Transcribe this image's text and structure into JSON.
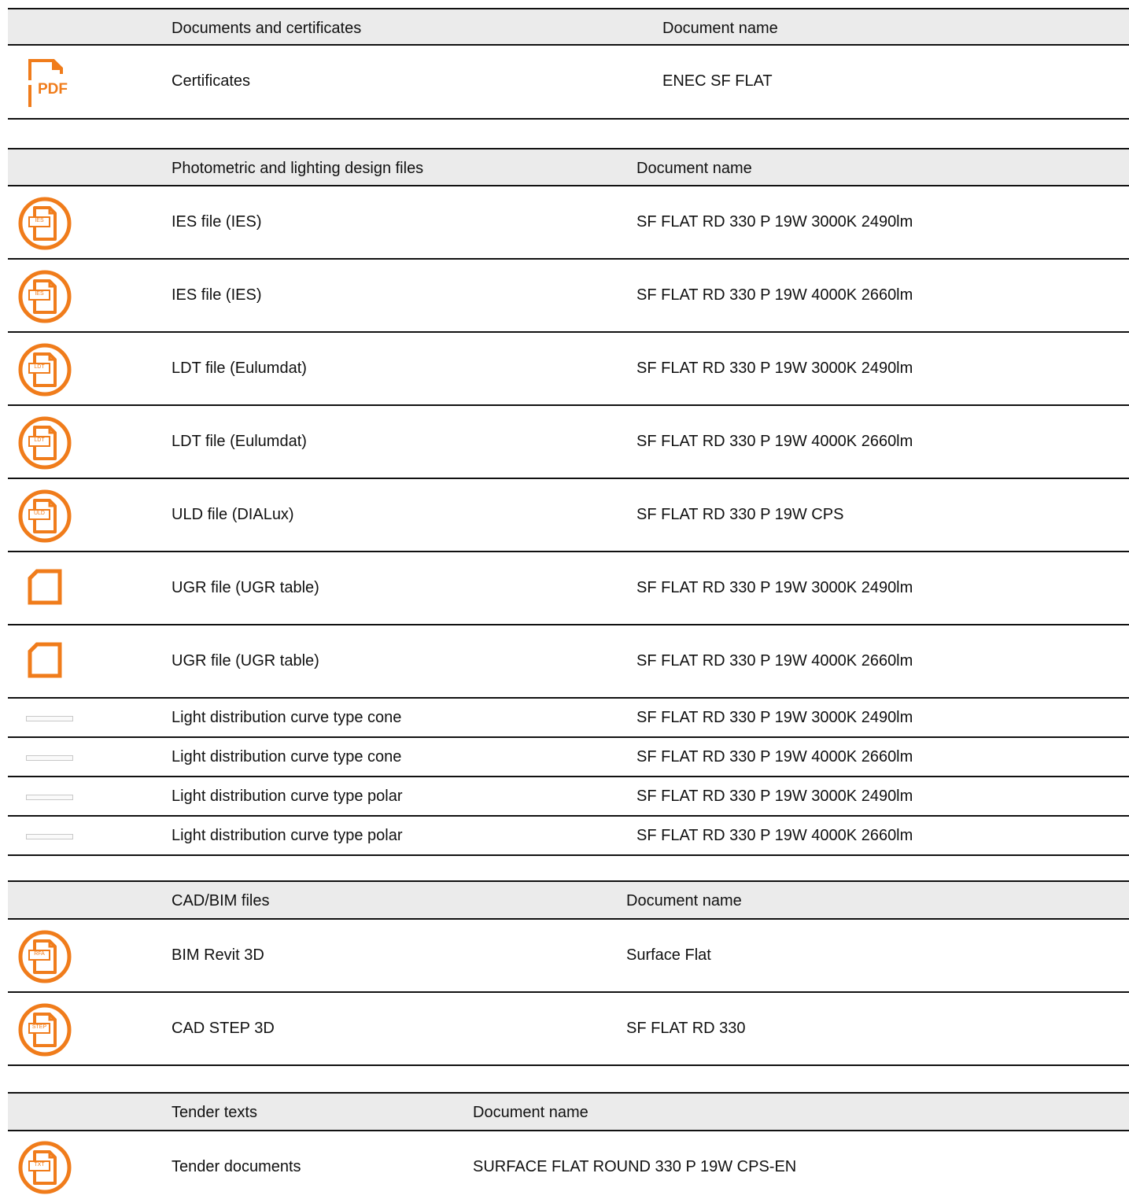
{
  "accent_color": "#f07c1b",
  "sections": [
    {
      "title": "Documents and certificates",
      "name_header": "Document name",
      "rows": [
        {
          "icon": "pdf-icon",
          "type": "Certificates",
          "name": "ENEC SF FLAT"
        }
      ]
    },
    {
      "title": "Photometric and lighting design files",
      "name_header": "Document name",
      "rows": [
        {
          "icon": "ies-file-icon",
          "icon_label": "IES",
          "type": "IES file (IES)",
          "name": "SF FLAT RD 330 P 19W 3000K 2490lm"
        },
        {
          "icon": "ies-file-icon",
          "icon_label": "IES",
          "type": "IES file (IES)",
          "name": "SF FLAT RD 330 P 19W 4000K 2660lm"
        },
        {
          "icon": "ldt-file-icon",
          "icon_label": "LDT",
          "type": "LDT file (Eulumdat)",
          "name": "SF FLAT RD 330 P 19W 3000K 2490lm"
        },
        {
          "icon": "ldt-file-icon",
          "icon_label": "LDT",
          "type": "LDT file (Eulumdat)",
          "name": "SF FLAT RD 330 P 19W 4000K 2660lm"
        },
        {
          "icon": "uld-file-icon",
          "icon_label": "ULD",
          "type": "ULD file (DIALux)",
          "name": "SF FLAT RD 330 P 19W CPS"
        },
        {
          "icon": "blank-file-icon",
          "type": "UGR file (UGR table)",
          "name": "SF FLAT RD 330 P 19W 3000K 2490lm"
        },
        {
          "icon": "blank-file-icon",
          "type": "UGR file (UGR table)",
          "name": "SF FLAT RD 330 P 19W 4000K 2660lm"
        },
        {
          "icon": "thumbnail-placeholder-icon",
          "type": "Light distribution curve type cone",
          "name": "SF FLAT RD 330 P 19W 3000K 2490lm"
        },
        {
          "icon": "thumbnail-placeholder-icon",
          "type": "Light distribution curve type cone",
          "name": "SF FLAT RD 330 P 19W 4000K 2660lm"
        },
        {
          "icon": "thumbnail-placeholder-icon",
          "type": "Light distribution curve type polar",
          "name": "SF FLAT RD 330 P 19W 3000K 2490lm"
        },
        {
          "icon": "thumbnail-placeholder-icon",
          "type": "Light distribution curve type polar",
          "name": "SF FLAT RD 330 P 19W 4000K 2660lm"
        }
      ]
    },
    {
      "title": "CAD/BIM files",
      "name_header": "Document name",
      "rows": [
        {
          "icon": "rfa-file-icon",
          "icon_label": "RFA",
          "type": "BIM Revit 3D",
          "name": "Surface Flat"
        },
        {
          "icon": "step-file-icon",
          "icon_label": "STEP",
          "type": "CAD STEP 3D",
          "name": "SF FLAT RD 330"
        }
      ]
    },
    {
      "title": "Tender texts",
      "name_header": "Document name",
      "rows": [
        {
          "icon": "txt-file-icon",
          "icon_label": "TXT",
          "type": "Tender documents",
          "name": "SURFACE FLAT ROUND 330 P 19W CPS-EN"
        }
      ]
    }
  ]
}
